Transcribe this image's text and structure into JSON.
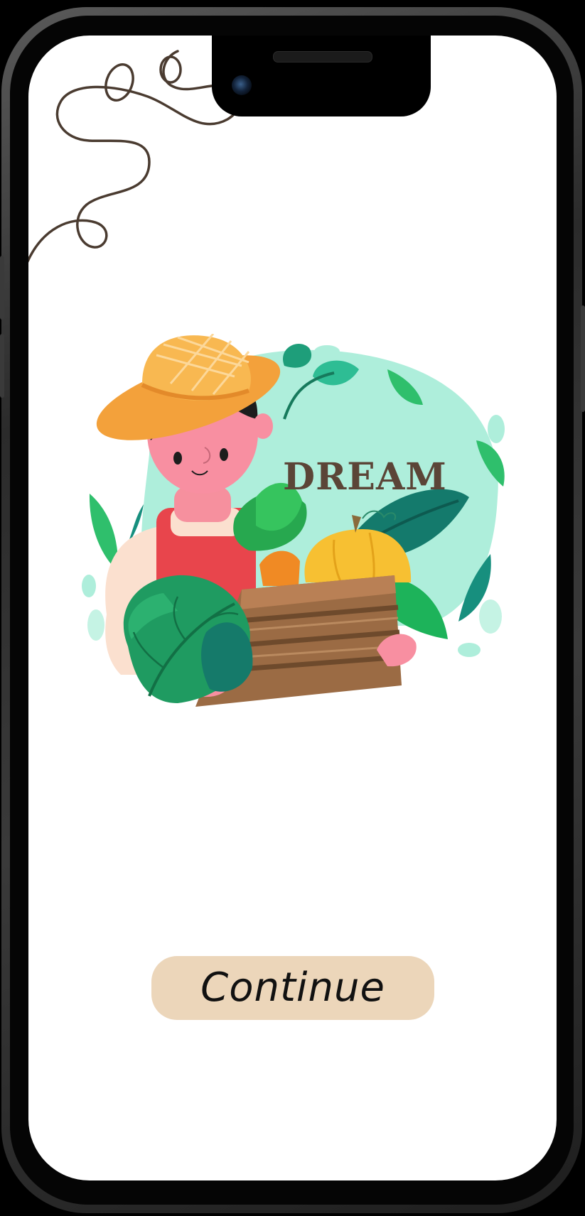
{
  "splash": {
    "brand_word": "DREAM",
    "continue_label": "Continue"
  },
  "colors": {
    "screen_background": "#ffffff",
    "button_background": "#ecd6ba",
    "button_text": "#111111",
    "brand_text": "#5b4537",
    "squiggle": "#4a3b30",
    "blob": "#aeeedb"
  },
  "icons": {
    "decoration": "squiggle-decoration",
    "illustration": "farmer-with-vegetable-crate"
  }
}
